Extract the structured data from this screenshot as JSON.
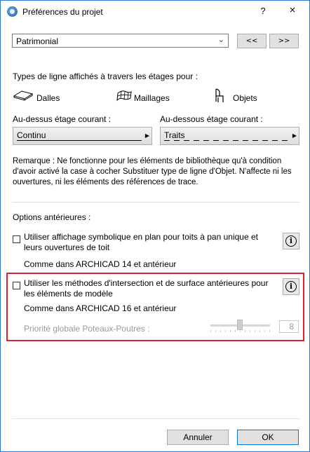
{
  "window": {
    "title": "Préférences du projet",
    "help_label": "?",
    "close_label": "×"
  },
  "preset": {
    "selected": "Patrimonial",
    "prev_label": "<<",
    "next_label": ">>"
  },
  "line_types": {
    "heading": "Types de ligne affichés à travers les étages pour :",
    "items": [
      {
        "label": "Dalles",
        "icon": "slab-icon"
      },
      {
        "label": "Maillages",
        "icon": "mesh-icon"
      },
      {
        "label": "Objets",
        "icon": "object-chair-icon"
      }
    ],
    "above_label": "Au-dessus étage courant :",
    "above_value": "Continu",
    "below_label": "Au-dessous étage courant :",
    "below_value": "Traits"
  },
  "remark": "Remarque : Ne fonctionne pour les éléments de bibliothèque qu'à condition d'avoir activé la case à cocher Substituer type de ligne d'Objet. N'affecte ni les ouvertures, ni les éléments des références de trace.",
  "legacy": {
    "heading": "Options antérieures :",
    "option1": {
      "label": "Utiliser affichage symbolique en plan pour toits à pan unique et leurs ouvertures de toit",
      "note": "Comme dans ARCHICAD 14 et antérieur",
      "checked": false
    },
    "option2": {
      "label": "Utiliser les méthodes d'intersection et de surface antérieures pour les éléments de modèle",
      "note": "Comme dans ARCHICAD 16 et antérieur",
      "checked": false
    },
    "priority_label": "Priorité globale Poteaux-Poutres :",
    "priority_value": "8"
  },
  "footer": {
    "cancel_label": "Annuler",
    "ok_label": "OK"
  },
  "colors": {
    "highlight": "#e0202a",
    "window_border": "#2b79d6"
  }
}
